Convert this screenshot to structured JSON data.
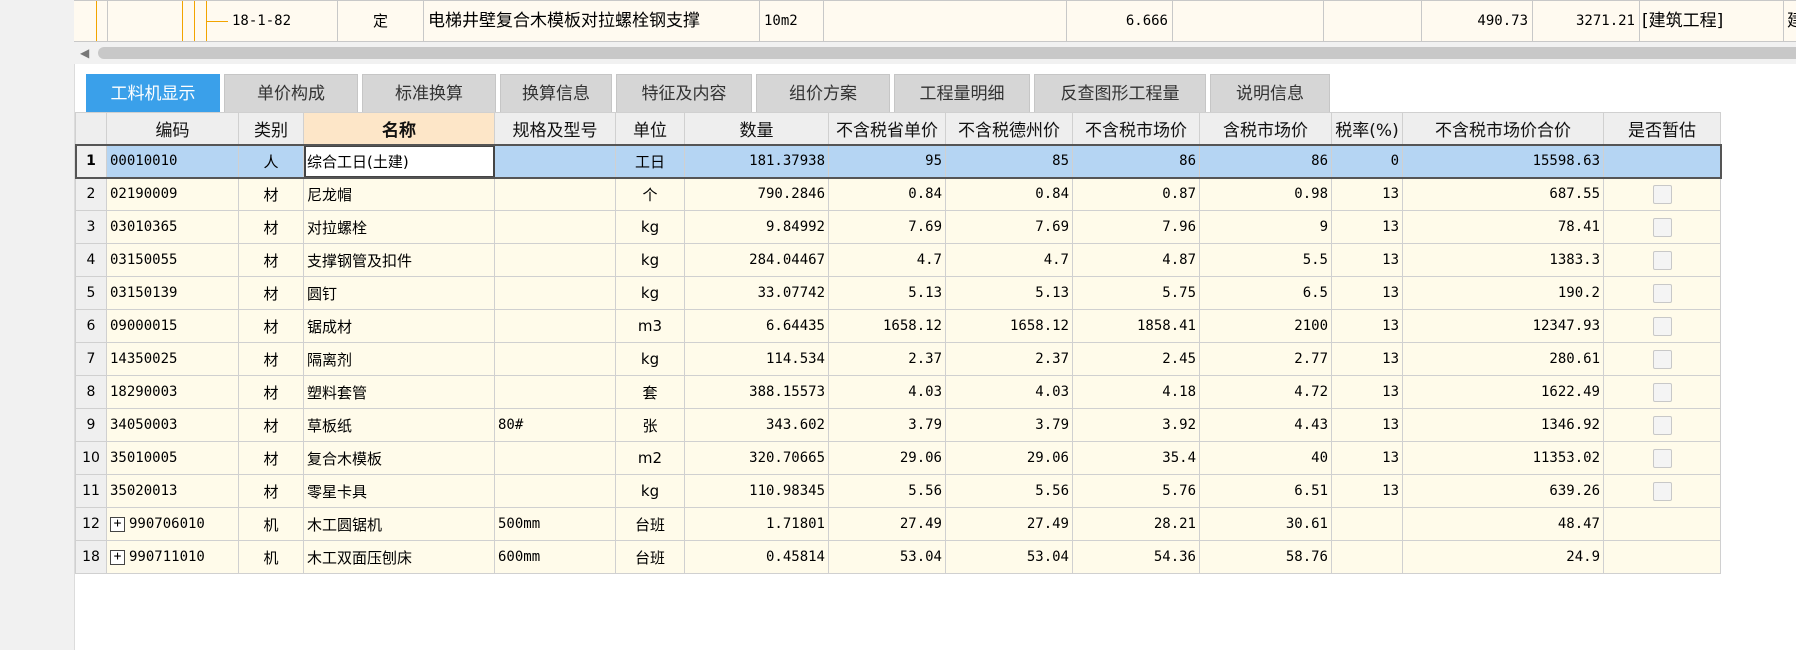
{
  "top_row": {
    "code": "18-1-82",
    "type": "定",
    "name": "电梯井壁复合木模板对拉螺栓钢支撑",
    "unit": "10m2",
    "quantity": "6.666",
    "price": "490.73",
    "total": "3271.21",
    "category": "[建筑工程]",
    "specialty": "建筑工程"
  },
  "tabs": [
    {
      "label": "工料机显示",
      "active": true
    },
    {
      "label": "单价构成"
    },
    {
      "label": "标准换算"
    },
    {
      "label": "换算信息"
    },
    {
      "label": "特征及内容"
    },
    {
      "label": "组价方案"
    },
    {
      "label": "工程量明细"
    },
    {
      "label": "反查图形工程量"
    },
    {
      "label": "说明信息"
    }
  ],
  "columns": {
    "code": "编码",
    "type": "类别",
    "name": "名称",
    "spec": "规格及型号",
    "unit": "单位",
    "qty": "数量",
    "prov_price": "不含税省单价",
    "dezhou_price": "不含税德州价",
    "market_price": "不含税市场价",
    "tax_market_price": "含税市场价",
    "tax_rate": "税率(%)",
    "market_total": "不含税市场价合价",
    "provisional": "是否暂估"
  },
  "rows": [
    {
      "n": "1",
      "code": "00010010",
      "type": "人",
      "name": "综合工日(土建)",
      "spec": "",
      "unit": "工日",
      "qty": "181.37938",
      "p1": "95",
      "p2": "85",
      "p3": "86",
      "p4": "86",
      "tax": "0",
      "total": "15598.63",
      "chk": false,
      "exp": false
    },
    {
      "n": "2",
      "code": "02190009",
      "type": "材",
      "name": "尼龙帽",
      "spec": "",
      "unit": "个",
      "qty": "790.2846",
      "p1": "0.84",
      "p2": "0.84",
      "p3": "0.87",
      "p4": "0.98",
      "tax": "13",
      "total": "687.55",
      "chk": true,
      "exp": false
    },
    {
      "n": "3",
      "code": "03010365",
      "type": "材",
      "name": "对拉螺栓",
      "spec": "",
      "unit": "kg",
      "qty": "9.84992",
      "p1": "7.69",
      "p2": "7.69",
      "p3": "7.96",
      "p4": "9",
      "tax": "13",
      "total": "78.41",
      "chk": true,
      "exp": false
    },
    {
      "n": "4",
      "code": "03150055",
      "type": "材",
      "name": "支撑钢管及扣件",
      "spec": "",
      "unit": "kg",
      "qty": "284.04467",
      "p1": "4.7",
      "p2": "4.7",
      "p3": "4.87",
      "p4": "5.5",
      "tax": "13",
      "total": "1383.3",
      "chk": true,
      "exp": false
    },
    {
      "n": "5",
      "code": "03150139",
      "type": "材",
      "name": "圆钉",
      "spec": "",
      "unit": "kg",
      "qty": "33.07742",
      "p1": "5.13",
      "p2": "5.13",
      "p3": "5.75",
      "p4": "6.5",
      "tax": "13",
      "total": "190.2",
      "chk": true,
      "exp": false
    },
    {
      "n": "6",
      "code": "09000015",
      "type": "材",
      "name": "锯成材",
      "spec": "",
      "unit": "m3",
      "qty": "6.64435",
      "p1": "1658.12",
      "p2": "1658.12",
      "p3": "1858.41",
      "p4": "2100",
      "tax": "13",
      "total": "12347.93",
      "chk": true,
      "exp": false
    },
    {
      "n": "7",
      "code": "14350025",
      "type": "材",
      "name": "隔离剂",
      "spec": "",
      "unit": "kg",
      "qty": "114.534",
      "p1": "2.37",
      "p2": "2.37",
      "p3": "2.45",
      "p4": "2.77",
      "tax": "13",
      "total": "280.61",
      "chk": true,
      "exp": false
    },
    {
      "n": "8",
      "code": "18290003",
      "type": "材",
      "name": "塑料套管",
      "spec": "",
      "unit": "套",
      "qty": "388.15573",
      "p1": "4.03",
      "p2": "4.03",
      "p3": "4.18",
      "p4": "4.72",
      "tax": "13",
      "total": "1622.49",
      "chk": true,
      "exp": false
    },
    {
      "n": "9",
      "code": "34050003",
      "type": "材",
      "name": "草板纸",
      "spec": "80#",
      "unit": "张",
      "qty": "343.602",
      "p1": "3.79",
      "p2": "3.79",
      "p3": "3.92",
      "p4": "4.43",
      "tax": "13",
      "total": "1346.92",
      "chk": true,
      "exp": false
    },
    {
      "n": "10",
      "code": "35010005",
      "type": "材",
      "name": "复合木模板",
      "spec": "",
      "unit": "m2",
      "qty": "320.70665",
      "p1": "29.06",
      "p2": "29.06",
      "p3": "35.4",
      "p4": "40",
      "tax": "13",
      "total": "11353.02",
      "chk": true,
      "exp": false
    },
    {
      "n": "11",
      "code": "35020013",
      "type": "材",
      "name": "零星卡具",
      "spec": "",
      "unit": "kg",
      "qty": "110.98345",
      "p1": "5.56",
      "p2": "5.56",
      "p3": "5.76",
      "p4": "6.51",
      "tax": "13",
      "total": "639.26",
      "chk": true,
      "exp": false
    },
    {
      "n": "12",
      "code": "990706010",
      "type": "机",
      "name": "木工圆锯机",
      "spec": "500mm",
      "unit": "台班",
      "qty": "1.71801",
      "p1": "27.49",
      "p2": "27.49",
      "p3": "28.21",
      "p4": "30.61",
      "tax": "",
      "total": "48.47",
      "chk": false,
      "exp": true
    },
    {
      "n": "18",
      "code": "990711010",
      "type": "机",
      "name": "木工双面压刨床",
      "spec": "600mm",
      "unit": "台班",
      "qty": "0.45814",
      "p1": "53.04",
      "p2": "53.04",
      "p3": "54.36",
      "p4": "58.76",
      "tax": "",
      "total": "24.9",
      "chk": false,
      "exp": true
    }
  ],
  "colors": {
    "active_tab": "#3aa0ea",
    "grid_bg": "#fffbea",
    "selected_row": "#b5d5f3",
    "tree_line": "#f2a400"
  }
}
